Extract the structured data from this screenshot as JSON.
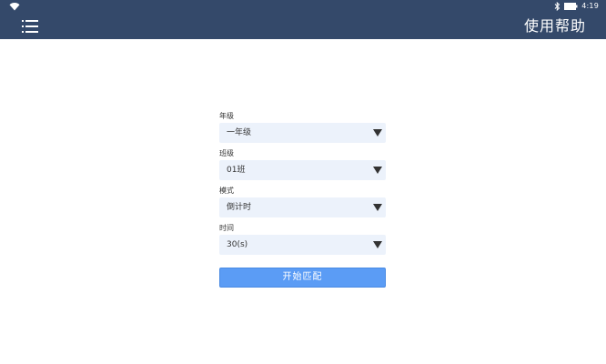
{
  "status_bar": {
    "time": "4:19",
    "icons": [
      "wifi-icon",
      "bluetooth-icon",
      "battery-icon"
    ]
  },
  "header": {
    "menu_icon": "hamburger-menu-icon",
    "help_label": "使用帮助"
  },
  "form": {
    "fields": [
      {
        "label": "年级",
        "value": "一年级"
      },
      {
        "label": "班级",
        "value": "01班"
      },
      {
        "label": "模式",
        "value": "倒计时"
      },
      {
        "label": "时间",
        "value": "30(s)"
      }
    ],
    "submit_label": "开始匹配"
  },
  "colors": {
    "header_bg": "#34496a",
    "select_bg": "#ecf2fb",
    "button_bg": "#5b9cf5",
    "caret": "#333333"
  }
}
